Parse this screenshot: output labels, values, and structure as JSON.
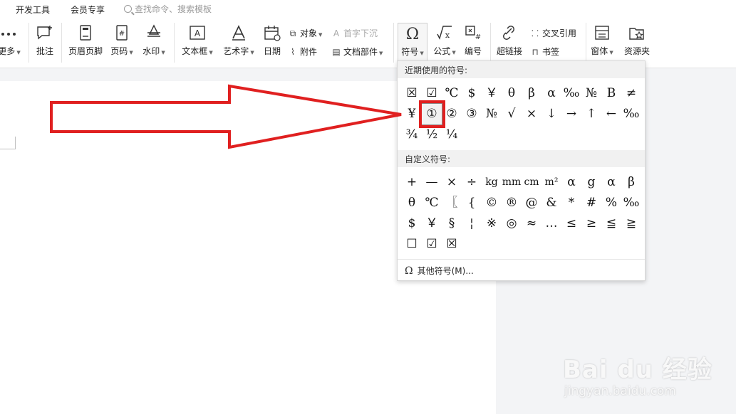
{
  "menubar": {
    "tabs": [
      "开发工具",
      "会员专享"
    ],
    "search_placeholder": "查找命令、搜索模板"
  },
  "ribbon": {
    "more": "更多",
    "comment": "批注",
    "header_footer": "页眉页脚",
    "page_number": "页码",
    "watermark": "水印",
    "textbox": "文本框",
    "wordart": "艺术字",
    "date": "日期",
    "object": "对象",
    "attachment": "附件",
    "drop_cap": "首字下沉",
    "doc_parts": "文档部件",
    "symbol": "符号",
    "formula": "公式",
    "numbering": "编号",
    "hyperlink": "超链接",
    "cross_ref": "交叉引用",
    "bookmark": "书签",
    "form": "窗体",
    "resources": "资源夹"
  },
  "dropdown": {
    "recent_header": "近期使用的符号:",
    "recent_symbols": [
      "☒",
      "☑",
      "℃",
      "$",
      "￥",
      "θ",
      "β",
      "α",
      "‰",
      "№",
      "B",
      "≠",
      "¥",
      "①",
      "②",
      "③",
      "№",
      "√",
      "×",
      "↓",
      "→",
      "↑",
      "←",
      "‰",
      "¾",
      "½",
      "¼"
    ],
    "selected_index": 13,
    "custom_header": "自定义符号:",
    "custom_symbols": [
      "+",
      "—",
      "×",
      "÷",
      "kg",
      "mm",
      "cm",
      "m²",
      "α",
      "g",
      "α",
      "β",
      "θ",
      "℃",
      "〖",
      "{",
      "©",
      "®",
      "@",
      "&",
      "*",
      "#",
      "%",
      "‰",
      "$",
      "￥",
      "§",
      "¦",
      "※",
      "◎",
      "≈",
      "…",
      "≤",
      "≥",
      "≦",
      "≧",
      "☐",
      "☑",
      "☒"
    ],
    "more_symbols": "其他符号(M)..."
  },
  "colors": {
    "annotation_red": "#e02020",
    "accent_gray": "#f1f1f1"
  },
  "watermark": {
    "brand": "Bai du 经验",
    "url": "jingyan.baidu.com"
  }
}
